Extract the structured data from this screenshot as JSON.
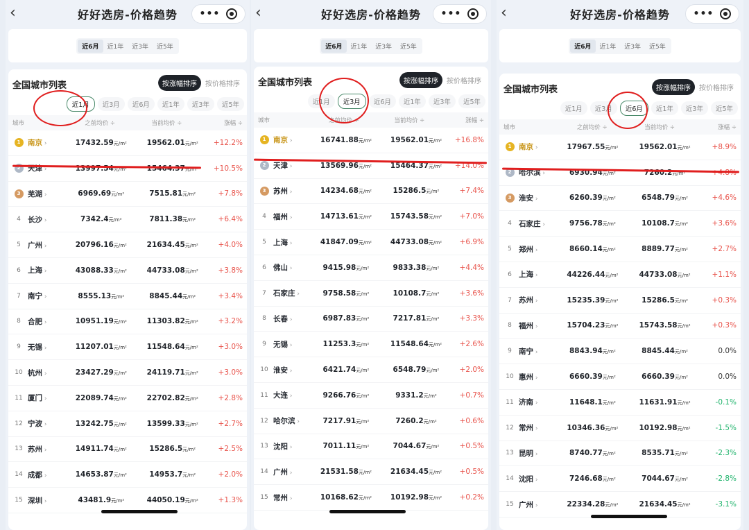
{
  "panels": [
    {
      "nav": {
        "title": "好好选房-价格趋势",
        "back": "‹",
        "more": "•••"
      },
      "range_tabs": [
        "近6月",
        "近1年",
        "近3年",
        "近5年"
      ],
      "list_title": "全国城市列表",
      "sort": [
        "按涨幅排序",
        "按价格排序"
      ],
      "periods": [
        "近1月",
        "近3月",
        "近6月",
        "近1年",
        "近3年",
        "近5年"
      ],
      "columns": [
        "城市",
        "之前均价 ÷",
        "当前均价 ÷",
        "涨幅 ÷"
      ],
      "rows": [
        {
          "rank": "1",
          "city": "南京",
          "prev": "17432.59",
          "cur": "19562.01",
          "chg": "+12.2%"
        },
        {
          "rank": "2",
          "city": "天津",
          "prev": "13997.54",
          "cur": "15464.37",
          "chg": "+10.5%"
        },
        {
          "rank": "3",
          "city": "芜湖",
          "prev": "6969.69",
          "cur": "7515.81",
          "chg": "+7.8%"
        },
        {
          "rank": "4",
          "city": "长沙",
          "prev": "7342.4",
          "cur": "7811.38",
          "chg": "+6.4%"
        },
        {
          "rank": "5",
          "city": "广州",
          "prev": "20796.16",
          "cur": "21634.45",
          "chg": "+4.0%"
        },
        {
          "rank": "6",
          "city": "上海",
          "prev": "43088.33",
          "cur": "44733.08",
          "chg": "+3.8%"
        },
        {
          "rank": "7",
          "city": "南宁",
          "prev": "8555.13",
          "cur": "8845.44",
          "chg": "+3.4%"
        },
        {
          "rank": "8",
          "city": "合肥",
          "prev": "10951.19",
          "cur": "11303.82",
          "chg": "+3.2%"
        },
        {
          "rank": "9",
          "city": "无锡",
          "prev": "11207.01",
          "cur": "11548.64",
          "chg": "+3.0%"
        },
        {
          "rank": "10",
          "city": "杭州",
          "prev": "23427.29",
          "cur": "24119.71",
          "chg": "+3.0%"
        },
        {
          "rank": "11",
          "city": "厦门",
          "prev": "22089.74",
          "cur": "22702.82",
          "chg": "+2.8%"
        },
        {
          "rank": "12",
          "city": "宁波",
          "prev": "13242.75",
          "cur": "13599.33",
          "chg": "+2.7%"
        },
        {
          "rank": "13",
          "city": "苏州",
          "prev": "14911.74",
          "cur": "15286.5",
          "chg": "+2.5%"
        },
        {
          "rank": "14",
          "city": "成都",
          "prev": "14653.87",
          "cur": "14953.7",
          "chg": "+2.0%"
        },
        {
          "rank": "15",
          "city": "深圳",
          "prev": "43481.9",
          "cur": "44050.19",
          "chg": "+1.3%"
        }
      ]
    },
    {
      "nav": {
        "title": "好好选房-价格趋势",
        "back": "‹",
        "more": "•••"
      },
      "range_tabs": [
        "近6月",
        "近1年",
        "近3年",
        "近5年"
      ],
      "list_title": "全国城市列表",
      "sort": [
        "按涨幅排序",
        "按价格排序"
      ],
      "periods": [
        "近1月",
        "近3月",
        "近6月",
        "近1年",
        "近3年",
        "近5年"
      ],
      "columns": [
        "城市",
        "之前均价 ÷",
        "当前均价 ÷",
        "涨幅 ÷"
      ],
      "rows": [
        {
          "rank": "1",
          "city": "南京",
          "prev": "16741.88",
          "cur": "19562.01",
          "chg": "+16.8%"
        },
        {
          "rank": "2",
          "city": "天津",
          "prev": "13569.96",
          "cur": "15464.37",
          "chg": "+14.0%"
        },
        {
          "rank": "3",
          "city": "苏州",
          "prev": "14234.68",
          "cur": "15286.5",
          "chg": "+7.4%"
        },
        {
          "rank": "4",
          "city": "福州",
          "prev": "14713.61",
          "cur": "15743.58",
          "chg": "+7.0%"
        },
        {
          "rank": "5",
          "city": "上海",
          "prev": "41847.09",
          "cur": "44733.08",
          "chg": "+6.9%"
        },
        {
          "rank": "6",
          "city": "佛山",
          "prev": "9415.98",
          "cur": "9833.38",
          "chg": "+4.4%"
        },
        {
          "rank": "7",
          "city": "石家庄",
          "prev": "9758.58",
          "cur": "10108.7",
          "chg": "+3.6%"
        },
        {
          "rank": "8",
          "city": "长春",
          "prev": "6987.83",
          "cur": "7217.81",
          "chg": "+3.3%"
        },
        {
          "rank": "9",
          "city": "无锡",
          "prev": "11253.3",
          "cur": "11548.64",
          "chg": "+2.6%"
        },
        {
          "rank": "10",
          "city": "淮安",
          "prev": "6421.74",
          "cur": "6548.79",
          "chg": "+2.0%"
        },
        {
          "rank": "11",
          "city": "大连",
          "prev": "9266.76",
          "cur": "9331.2",
          "chg": "+0.7%"
        },
        {
          "rank": "12",
          "city": "哈尔滨",
          "prev": "7217.91",
          "cur": "7260.2",
          "chg": "+0.6%"
        },
        {
          "rank": "13",
          "city": "沈阳",
          "prev": "7011.11",
          "cur": "7044.67",
          "chg": "+0.5%"
        },
        {
          "rank": "14",
          "city": "广州",
          "prev": "21531.58",
          "cur": "21634.45",
          "chg": "+0.5%"
        },
        {
          "rank": "15",
          "city": "常州",
          "prev": "10168.62",
          "cur": "10192.98",
          "chg": "+0.2%"
        }
      ]
    },
    {
      "nav": {
        "title": "好好选房-价格趋势",
        "back": "‹",
        "more": "•••"
      },
      "range_tabs": [
        "近6月",
        "近1年",
        "近3年",
        "近5年"
      ],
      "list_title": "全国城市列表",
      "sort": [
        "按涨幅排序",
        "按价格排序"
      ],
      "periods": [
        "近1月",
        "近3月",
        "近6月",
        "近1年",
        "近3年",
        "近5年"
      ],
      "columns": [
        "城市",
        "之前均价 ÷",
        "当前均价 ÷",
        "涨幅 ÷"
      ],
      "rows": [
        {
          "rank": "1",
          "city": "南京",
          "prev": "17967.55",
          "cur": "19562.01",
          "chg": "+8.9%"
        },
        {
          "rank": "2",
          "city": "哈尔滨",
          "prev": "6930.94",
          "cur": "7260.2",
          "chg": "+4.8%"
        },
        {
          "rank": "3",
          "city": "淮安",
          "prev": "6260.39",
          "cur": "6548.79",
          "chg": "+4.6%"
        },
        {
          "rank": "4",
          "city": "石家庄",
          "prev": "9756.78",
          "cur": "10108.7",
          "chg": "+3.6%"
        },
        {
          "rank": "5",
          "city": "郑州",
          "prev": "8660.14",
          "cur": "8889.77",
          "chg": "+2.7%"
        },
        {
          "rank": "6",
          "city": "上海",
          "prev": "44226.44",
          "cur": "44733.08",
          "chg": "+1.1%"
        },
        {
          "rank": "7",
          "city": "苏州",
          "prev": "15235.39",
          "cur": "15286.5",
          "chg": "+0.3%"
        },
        {
          "rank": "8",
          "city": "福州",
          "prev": "15704.23",
          "cur": "15743.58",
          "chg": "+0.3%"
        },
        {
          "rank": "9",
          "city": "南宁",
          "prev": "8843.94",
          "cur": "8845.44",
          "chg": "0.0%"
        },
        {
          "rank": "10",
          "city": "惠州",
          "prev": "6660.39",
          "cur": "6660.39",
          "chg": "0.0%"
        },
        {
          "rank": "11",
          "city": "济南",
          "prev": "11648.1",
          "cur": "11631.91",
          "chg": "-0.1%"
        },
        {
          "rank": "12",
          "city": "常州",
          "prev": "10346.36",
          "cur": "10192.98",
          "chg": "-1.5%"
        },
        {
          "rank": "13",
          "city": "昆明",
          "prev": "8740.77",
          "cur": "8535.71",
          "chg": "-2.3%"
        },
        {
          "rank": "14",
          "city": "沈阳",
          "prev": "7246.68",
          "cur": "7044.67",
          "chg": "-2.8%"
        },
        {
          "rank": "15",
          "city": "广州",
          "prev": "22334.28",
          "cur": "21634.45",
          "chg": "-3.1%"
        }
      ]
    }
  ],
  "unit": "元/m²",
  "active": {
    "range_tab": 0,
    "sort": 0,
    "period": [
      0,
      1,
      2
    ]
  },
  "colors": {
    "up": "#e8524a",
    "down": "#1fb36b",
    "annotation": "#e01e1e"
  }
}
